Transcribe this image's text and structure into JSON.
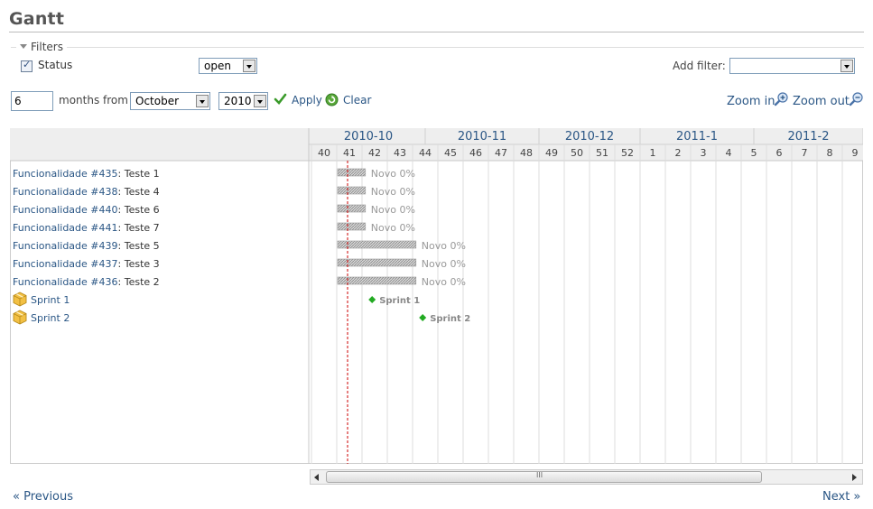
{
  "page": {
    "title": "Gantt"
  },
  "filters": {
    "legend": "Filters",
    "status_label": "Status",
    "status_checked": true,
    "status_operator": "open",
    "add_filter_label": "Add filter:",
    "add_filter_value": ""
  },
  "period": {
    "months": "6",
    "months_from_label": "months from",
    "month": "October",
    "year": "2010",
    "apply_label": "Apply",
    "clear_label": "Clear"
  },
  "zoom": {
    "in_label": "Zoom in",
    "out_label": "Zoom out"
  },
  "gantt": {
    "months": [
      "2010-10",
      "2010-11",
      "2010-12",
      "2011-1",
      "2011-2"
    ],
    "weeks": [
      "40",
      "41",
      "42",
      "43",
      "44",
      "45",
      "46",
      "47",
      "48",
      "49",
      "50",
      "51",
      "52",
      "1",
      "2",
      "3",
      "4",
      "5",
      "6",
      "7",
      "8",
      "9"
    ],
    "issues": [
      {
        "tracker": "Funcionalidade #435",
        "subject": ": Teste 1",
        "status_label": "Novo 0%"
      },
      {
        "tracker": "Funcionalidade #438",
        "subject": ": Teste 4",
        "status_label": "Novo 0%"
      },
      {
        "tracker": "Funcionalidade #440",
        "subject": ": Teste 6",
        "status_label": "Novo 0%"
      },
      {
        "tracker": "Funcionalidade #441",
        "subject": ": Teste 7",
        "status_label": "Novo 0%"
      },
      {
        "tracker": "Funcionalidade #439",
        "subject": ": Teste 5",
        "status_label": "Novo 0%"
      },
      {
        "tracker": "Funcionalidade #437",
        "subject": ": Teste 3",
        "status_label": "Novo 0%"
      },
      {
        "tracker": "Funcionalidade #436",
        "subject": ": Teste 2",
        "status_label": "Novo 0%"
      }
    ],
    "versions": [
      {
        "name": "Sprint 1",
        "label": "Sprint 1"
      },
      {
        "name": "Sprint 2",
        "label": "Sprint 2"
      }
    ],
    "scrollbar_grip": "III"
  },
  "pager": {
    "previous": "« Previous",
    "next": "Next »"
  },
  "colors": {
    "link": "#2a5685",
    "header_bg": "#eeeeee",
    "grid": "#dddddd",
    "today_line": "#cc0000",
    "milestone": "#22aa22"
  }
}
